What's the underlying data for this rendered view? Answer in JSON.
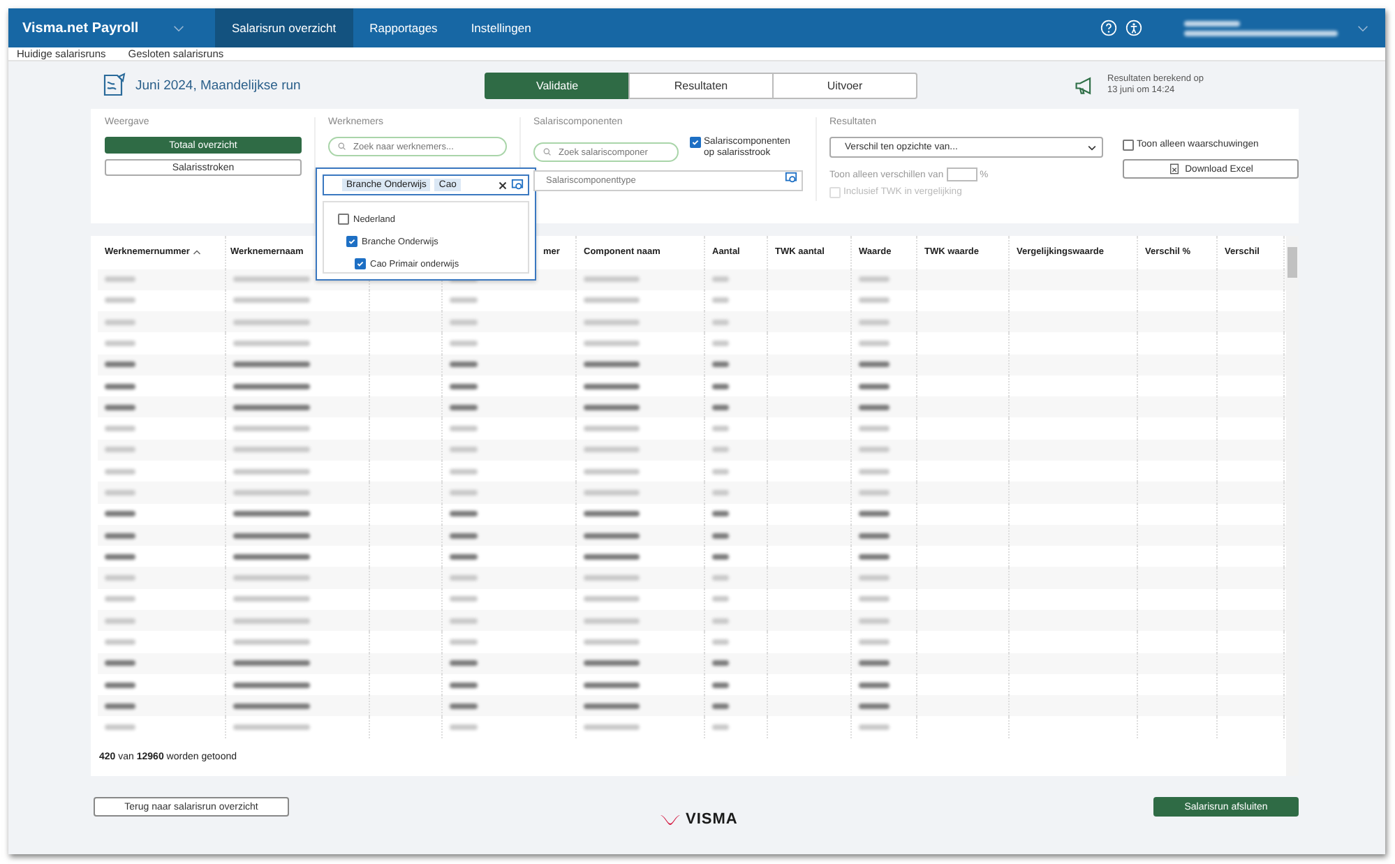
{
  "app_title": "Visma.net Payroll",
  "nav": [
    {
      "label": "Salarisrun overzicht",
      "selected": true
    },
    {
      "label": "Rapportages",
      "selected": false
    },
    {
      "label": "Instellingen",
      "selected": false
    }
  ],
  "subnav": [
    "Huidige salarisruns",
    "Gesloten salarisruns"
  ],
  "run_title": "Juni 2024, Maandelijkse run",
  "tabs": [
    {
      "label": "Validatie",
      "selected": true
    },
    {
      "label": "Resultaten",
      "selected": false
    },
    {
      "label": "Uitvoer",
      "selected": false
    }
  ],
  "calc_note": [
    "Resultaten berekend op",
    "13 juni om 14:24"
  ],
  "weergave": {
    "title": "Weergave",
    "buttons": [
      {
        "label": "Totaal overzicht",
        "selected": true
      },
      {
        "label": "Salarisstroken",
        "selected": false
      }
    ]
  },
  "werknemers": {
    "title": "Werknemers",
    "search_placeholder": "Zoek naar werknemers...",
    "chips": [
      "Branche Onderwijs",
      "Cao"
    ],
    "tree": [
      {
        "label": "Nederland",
        "checked": false,
        "children": [
          {
            "label": "Branche Onderwijs",
            "checked": true,
            "children": [
              {
                "label": "Cao Primair onderwijs",
                "checked": true
              }
            ]
          }
        ]
      }
    ]
  },
  "salariscomponenten": {
    "title": "Salariscomponenten",
    "search_placeholder": "Zoek salariscomponer",
    "checkbox": {
      "label": "Salariscomponenten op salarisstrook",
      "checked": true
    },
    "type_placeholder": "Salariscomponenttype"
  },
  "resultaten": {
    "title": "Resultaten",
    "select_value": "Verschil ten opzichte van...",
    "threshold_label": "Toon alleen verschillen van",
    "threshold_unit": "%",
    "twk_checkbox": {
      "label": "Inclusief TWK in vergelijking",
      "checked": false,
      "disabled": true
    },
    "warnings_checkbox": {
      "label": "Toon alleen waarschuwingen",
      "checked": false
    },
    "download": "Download Excel"
  },
  "table": {
    "columns": [
      {
        "label": "Werknemernummer",
        "sorted": true
      },
      {
        "label": "Werknemernaam"
      },
      {},
      {
        "label": "mer"
      },
      {
        "label": "Component naam"
      },
      {
        "label": "Aantal"
      },
      {
        "label": "TWK aantal"
      },
      {
        "label": "Waarde"
      },
      {
        "label": "TWK waarde"
      },
      {
        "label": "Vergelijkingswaarde"
      },
      {
        "label": "Verschil %"
      },
      {
        "label": "Verschil"
      }
    ],
    "rows": [
      {
        "bold": false
      },
      {
        "bold": false
      },
      {
        "bold": false
      },
      {
        "bold": false
      },
      {
        "bold": true
      },
      {
        "bold": true
      },
      {
        "bold": true
      },
      {
        "bold": false
      },
      {
        "bold": false
      },
      {
        "bold": false
      },
      {
        "bold": false
      },
      {
        "bold": true
      },
      {
        "bold": true
      },
      {
        "bold": true
      },
      {
        "bold": false
      },
      {
        "bold": false
      },
      {
        "bold": false
      },
      {
        "bold": false
      },
      {
        "bold": true
      },
      {
        "bold": true
      },
      {
        "bold": true
      },
      {
        "bold": false
      }
    ],
    "footer": "**420** van **12960** worden getoond"
  },
  "back_button": "Terug naar salarisrun overzicht",
  "close_button": "Salarisrun afsluiten",
  "logo": "VISMA"
}
